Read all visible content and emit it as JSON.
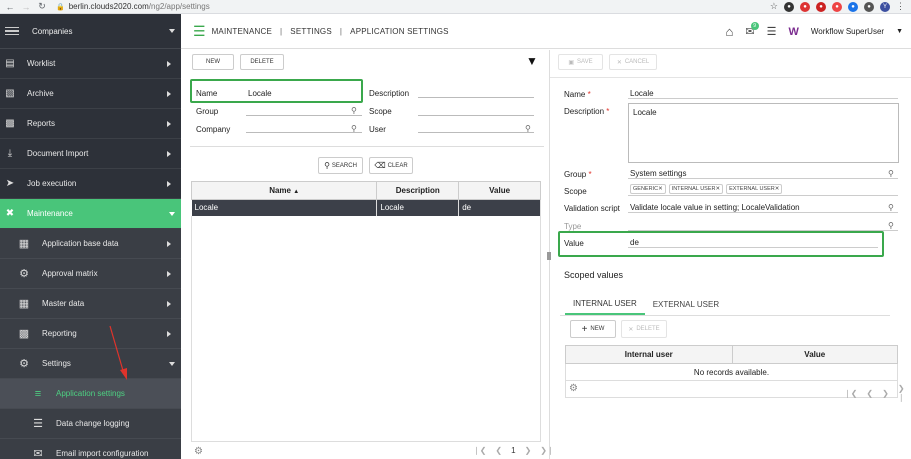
{
  "browser": {
    "url_host": "berlin.clouds2020.com",
    "url_path": "/ng2/app/settings"
  },
  "sidebar": {
    "header_label": "Companies",
    "items": [
      {
        "label": "Worklist",
        "icon": "worklist-icon"
      },
      {
        "label": "Archive",
        "icon": "archive-icon"
      },
      {
        "label": "Reports",
        "icon": "reports-icon"
      },
      {
        "label": "Document Import",
        "icon": "import-icon"
      },
      {
        "label": "Job execution",
        "icon": "rocket-icon"
      },
      {
        "label": "Maintenance",
        "icon": "tools-icon"
      }
    ],
    "maintenance_sub": [
      {
        "label": "Application base data",
        "icon": "base-data-icon"
      },
      {
        "label": "Approval matrix",
        "icon": "approval-icon"
      },
      {
        "label": "Master data",
        "icon": "grid-icon"
      },
      {
        "label": "Reporting",
        "icon": "reporting-icon"
      },
      {
        "label": "Settings",
        "icon": "gear-icon"
      }
    ],
    "settings_sub": [
      {
        "label": "Application settings",
        "icon": "sliders-icon"
      },
      {
        "label": "Data change logging",
        "icon": "log-icon"
      },
      {
        "label": "Email import configuration",
        "icon": "email-import-icon"
      }
    ]
  },
  "header": {
    "breadcrumb": [
      "MAINTENANCE",
      "SETTINGS",
      "APPLICATION SETTINGS"
    ],
    "notification_count": "9",
    "user_name": "Workflow SuperUser"
  },
  "left": {
    "new_label": "NEW",
    "delete_label": "DELETE",
    "filters": {
      "name_label": "Name",
      "name_value": "Locale",
      "description_label": "Description",
      "group_label": "Group",
      "scope_label": "Scope",
      "company_label": "Company",
      "user_label": "User"
    },
    "search_label": "SEARCH",
    "clear_label": "CLEAR",
    "table": {
      "columns": [
        "Name",
        "Description",
        "Value"
      ],
      "rows": [
        [
          "Locale",
          "Locale",
          "de"
        ]
      ]
    },
    "pager_page": "1"
  },
  "right": {
    "save_label": "SAVE",
    "cancel_label": "CANCEL",
    "name_label": "Name",
    "name_value": "Locale",
    "description_label": "Description",
    "description_value": "Locale",
    "group_label": "Group",
    "group_value": "System settings",
    "scope_label": "Scope",
    "scope_chips": [
      "GENERIC",
      "INTERNAL USER",
      "EXTERNAL USER"
    ],
    "validation_label": "Validation script",
    "validation_value": "Validate locale value in setting; LocaleValidation",
    "type_label": "Type",
    "value_label": "Value",
    "value_value": "de",
    "scoped_title": "Scoped values",
    "tabs": [
      "INTERNAL USER",
      "EXTERNAL USER"
    ],
    "scoped_new_label": "NEW",
    "scoped_delete_label": "DELETE",
    "scoped_columns": [
      "Internal user",
      "Value"
    ],
    "no_records": "No records available."
  },
  "colors": {
    "accent": "#49c57a",
    "sidebar_bg": "#2d3139",
    "highlight_box": "#3aa84c",
    "annotation_arrow": "#e0332b"
  }
}
